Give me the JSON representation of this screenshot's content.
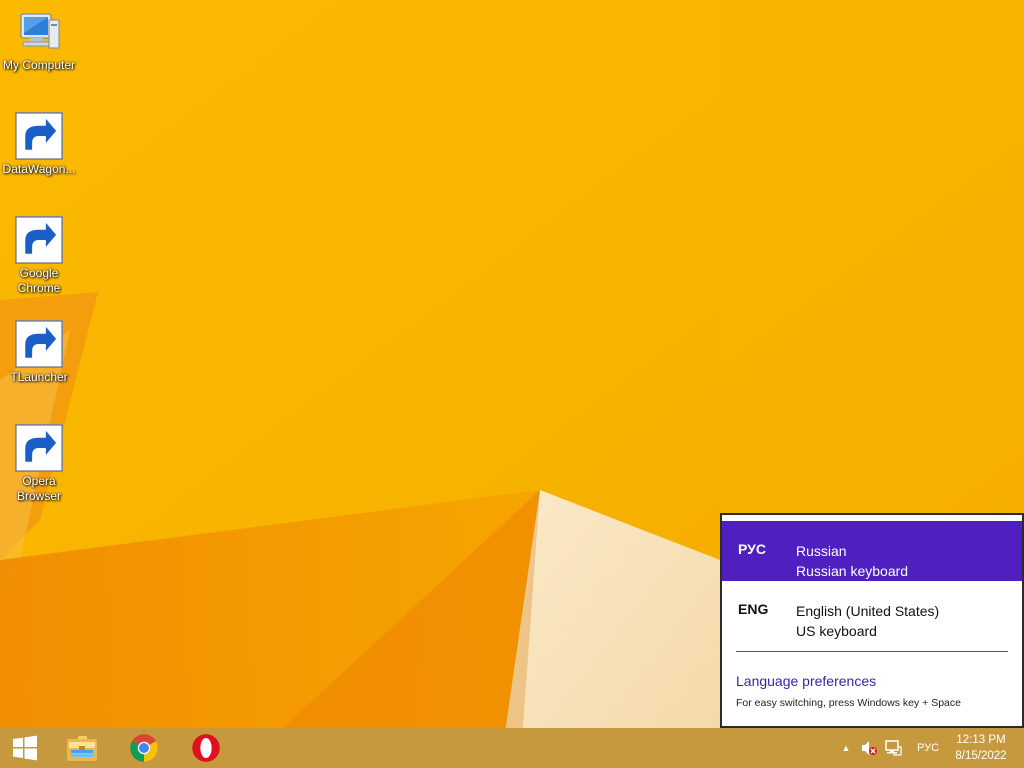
{
  "desktop": {
    "icons": [
      {
        "id": "my-computer",
        "label": "My Computer",
        "shortcut": false,
        "icon": "computer-icon"
      },
      {
        "id": "datawagon",
        "label": "DataWagon...",
        "shortcut": true,
        "icon": "datawagon-icon"
      },
      {
        "id": "chrome",
        "label": "Google Chrome",
        "shortcut": true,
        "icon": "chrome-icon"
      },
      {
        "id": "tlauncher",
        "label": "TLauncher",
        "shortcut": true,
        "icon": "tlauncher-icon"
      },
      {
        "id": "opera",
        "label": "Opera Browser",
        "shortcut": true,
        "icon": "opera-icon"
      }
    ]
  },
  "lang_flyout": {
    "items": [
      {
        "abbr": "РУС",
        "name": "Russian",
        "keyboard": "Russian keyboard",
        "selected": true
      },
      {
        "abbr": "ENG",
        "name": "English (United States)",
        "keyboard": "US keyboard",
        "selected": false
      }
    ],
    "preferences_link": "Language preferences",
    "hint": "For easy switching, press Windows key + Space",
    "selected_color": "#4f1fbf"
  },
  "taskbar": {
    "pinned": [
      {
        "name": "file-explorer",
        "icon": "folder-icon"
      },
      {
        "name": "google-chrome",
        "icon": "chrome-icon"
      },
      {
        "name": "opera",
        "icon": "opera-icon"
      }
    ],
    "tray": {
      "chevron": "▲",
      "language": "РУС",
      "time": "12:13 PM",
      "date": "8/15/2022"
    }
  },
  "colors": {
    "wallpaper_base": "#f6b300",
    "taskbar": "#c6993f"
  }
}
